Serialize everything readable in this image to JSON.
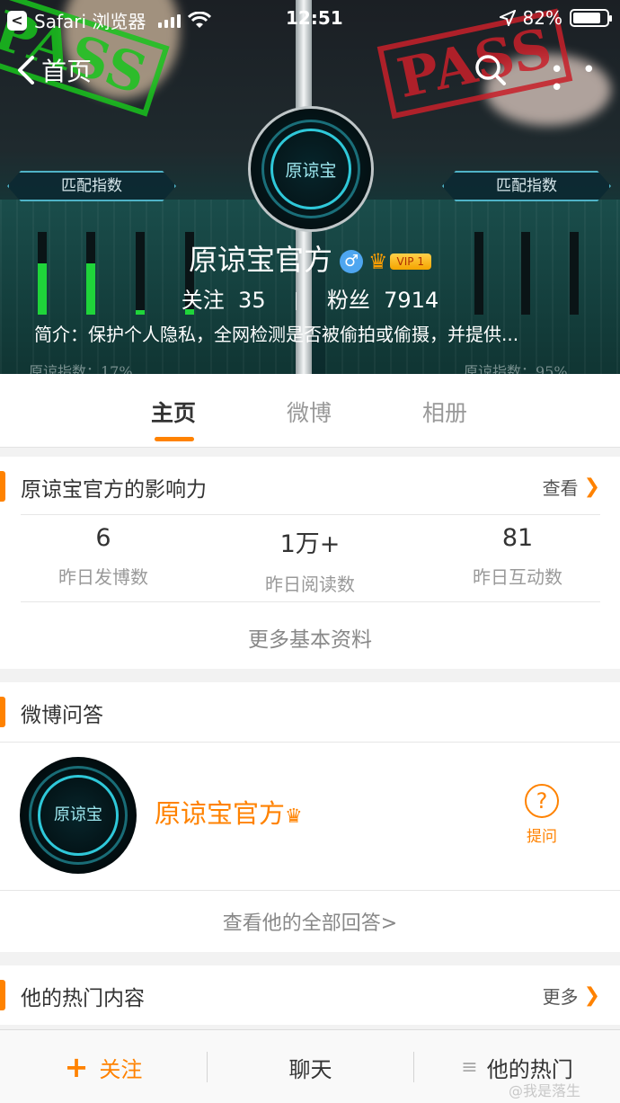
{
  "status_bar": {
    "back_app": "Safari 浏览器",
    "time": "12:51",
    "battery": "82%",
    "battery_level": 0.82
  },
  "nav": {
    "back_label": "首页",
    "more_label": "• • •"
  },
  "banner": {
    "left_tag": "匹配指数",
    "right_tag": "匹配指数",
    "left_score": "原谅指数：17%",
    "right_score": "原谅指数：95%",
    "stamp_text": "PASS",
    "stamp_text_left": "PASS"
  },
  "profile": {
    "avatar_text": "原谅宝",
    "name": "原谅宝官方",
    "gender_symbol": "♂",
    "crown_symbol": "♛",
    "vip_label": "VIP 1",
    "following_label": "关注",
    "following_count": "35",
    "followers_label": "粉丝",
    "followers_count": "7914",
    "intro": "简介：保护个人隐私，全网检测是否被偷拍或偷摄，并提供..."
  },
  "tabs": [
    {
      "label": "主页",
      "active": true
    },
    {
      "label": "微博",
      "active": false
    },
    {
      "label": "相册",
      "active": false
    }
  ],
  "influence": {
    "title": "原谅宝官方的影响力",
    "view_label": "查看",
    "stats": [
      {
        "value": "6",
        "label": "昨日发博数"
      },
      {
        "value": "1万+",
        "label": "昨日阅读数"
      },
      {
        "value": "81",
        "label": "昨日互动数"
      }
    ],
    "more_info": "更多基本资料"
  },
  "qa": {
    "title": "微博问答",
    "name": "原谅宝官方",
    "ask_label": "提问",
    "all_answers": "查看他的全部回答>"
  },
  "hot": {
    "title": "他的热门内容",
    "more_label": "更多"
  },
  "bottom_bar": {
    "follow_plus": "+",
    "follow": "关注",
    "chat": "聊天",
    "hot": "他的热门"
  },
  "watermark": "@我是落生",
  "colors": {
    "accent": "#ff8200",
    "meter_green": "#1fd43a",
    "gender_blue": "#4ea6f0"
  },
  "meters": {
    "left_levels": [
      0.62,
      0.62,
      0.05,
      0.06
    ],
    "right_levels": [
      0.0,
      0.0,
      0.0,
      0.0
    ]
  }
}
